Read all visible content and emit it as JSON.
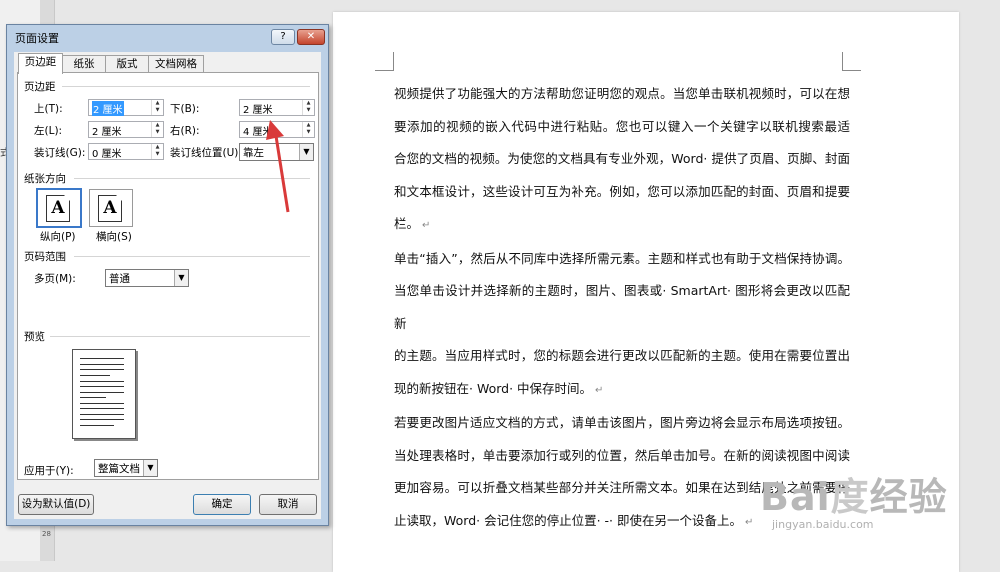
{
  "side_label": "式",
  "ruler_marks": [
    "1",
    "28"
  ],
  "dialog": {
    "title": "页面设置",
    "help_label": "?",
    "close_label": "✕",
    "tabs": [
      "页边距",
      "纸张",
      "版式",
      "文档网格"
    ],
    "margins_section": "页边距",
    "top_label": "上(T):",
    "top_value": "2 厘米",
    "bottom_label": "下(B):",
    "bottom_value": "2 厘米",
    "left_label": "左(L):",
    "left_value": "2 厘米",
    "right_label": "右(R):",
    "right_value": "4 厘米",
    "gutter_label": "装订线(G):",
    "gutter_value": "0 厘米",
    "gutter_pos_label": "装订线位置(U):",
    "gutter_pos_value": "靠左",
    "orientation_section": "纸张方向",
    "portrait_label": "纵向(P)",
    "landscape_label": "横向(S)",
    "page_icon_glyph": "A",
    "pages_section": "页码范围",
    "multiple_pages_label": "多页(M):",
    "multiple_pages_value": "普通",
    "preview_section": "预览",
    "apply_label": "应用于(Y):",
    "apply_value": "整篇文档",
    "set_default_label": "设为默认值(D)",
    "ok_label": "确定",
    "cancel_label": "取消"
  },
  "document": {
    "paragraphs": [
      [
        "视频提供了功能强大的方法帮助您证明您的观点。当您单击联机视频时，可以在想",
        "要添加的视频的嵌入代码中进行粘贴。您也可以键入一个关键字以联机搜索最适",
        "合您的文档的视频。为使您的文档具有专业外观，Word· 提供了页眉、页脚、封面",
        "和文本框设计，这些设计可互为补充。例如，您可以添加匹配的封面、页眉和提要",
        "栏。"
      ],
      [
        "单击“插入”，然后从不同库中选择所需元素。主题和样式也有助于文档保持协调。",
        "当您单击设计并选择新的主题时，图片、图表或· SmartArt· 图形将会更改以匹配新",
        "的主题。当应用样式时，您的标题会进行更改以匹配新的主题。使用在需要位置出",
        "现的新按钮在· Word· 中保存时间。"
      ],
      [
        "若要更改图片适应文档的方式，请单击该图片，图片旁边将会显示布局选项按钮。",
        "当处理表格时，单击要添加行或列的位置，然后单击加号。在新的阅读视图中阅读",
        "更加容易。可以折叠文档某些部分并关注所需文本。如果在达到结尾处之前需要停",
        "止读取，Word· 会记住您的停止位置· -· 即使在另一个设备上。"
      ]
    ],
    "para_mark": "↵"
  },
  "watermark": {
    "logo_text": "Bai",
    "logo_accent": "度",
    "logo_suffix": "经验",
    "url": "jingyan.baidu.com"
  },
  "colors": {
    "annotation_arrow": "#d93a3a",
    "selection": "#3399ff"
  }
}
